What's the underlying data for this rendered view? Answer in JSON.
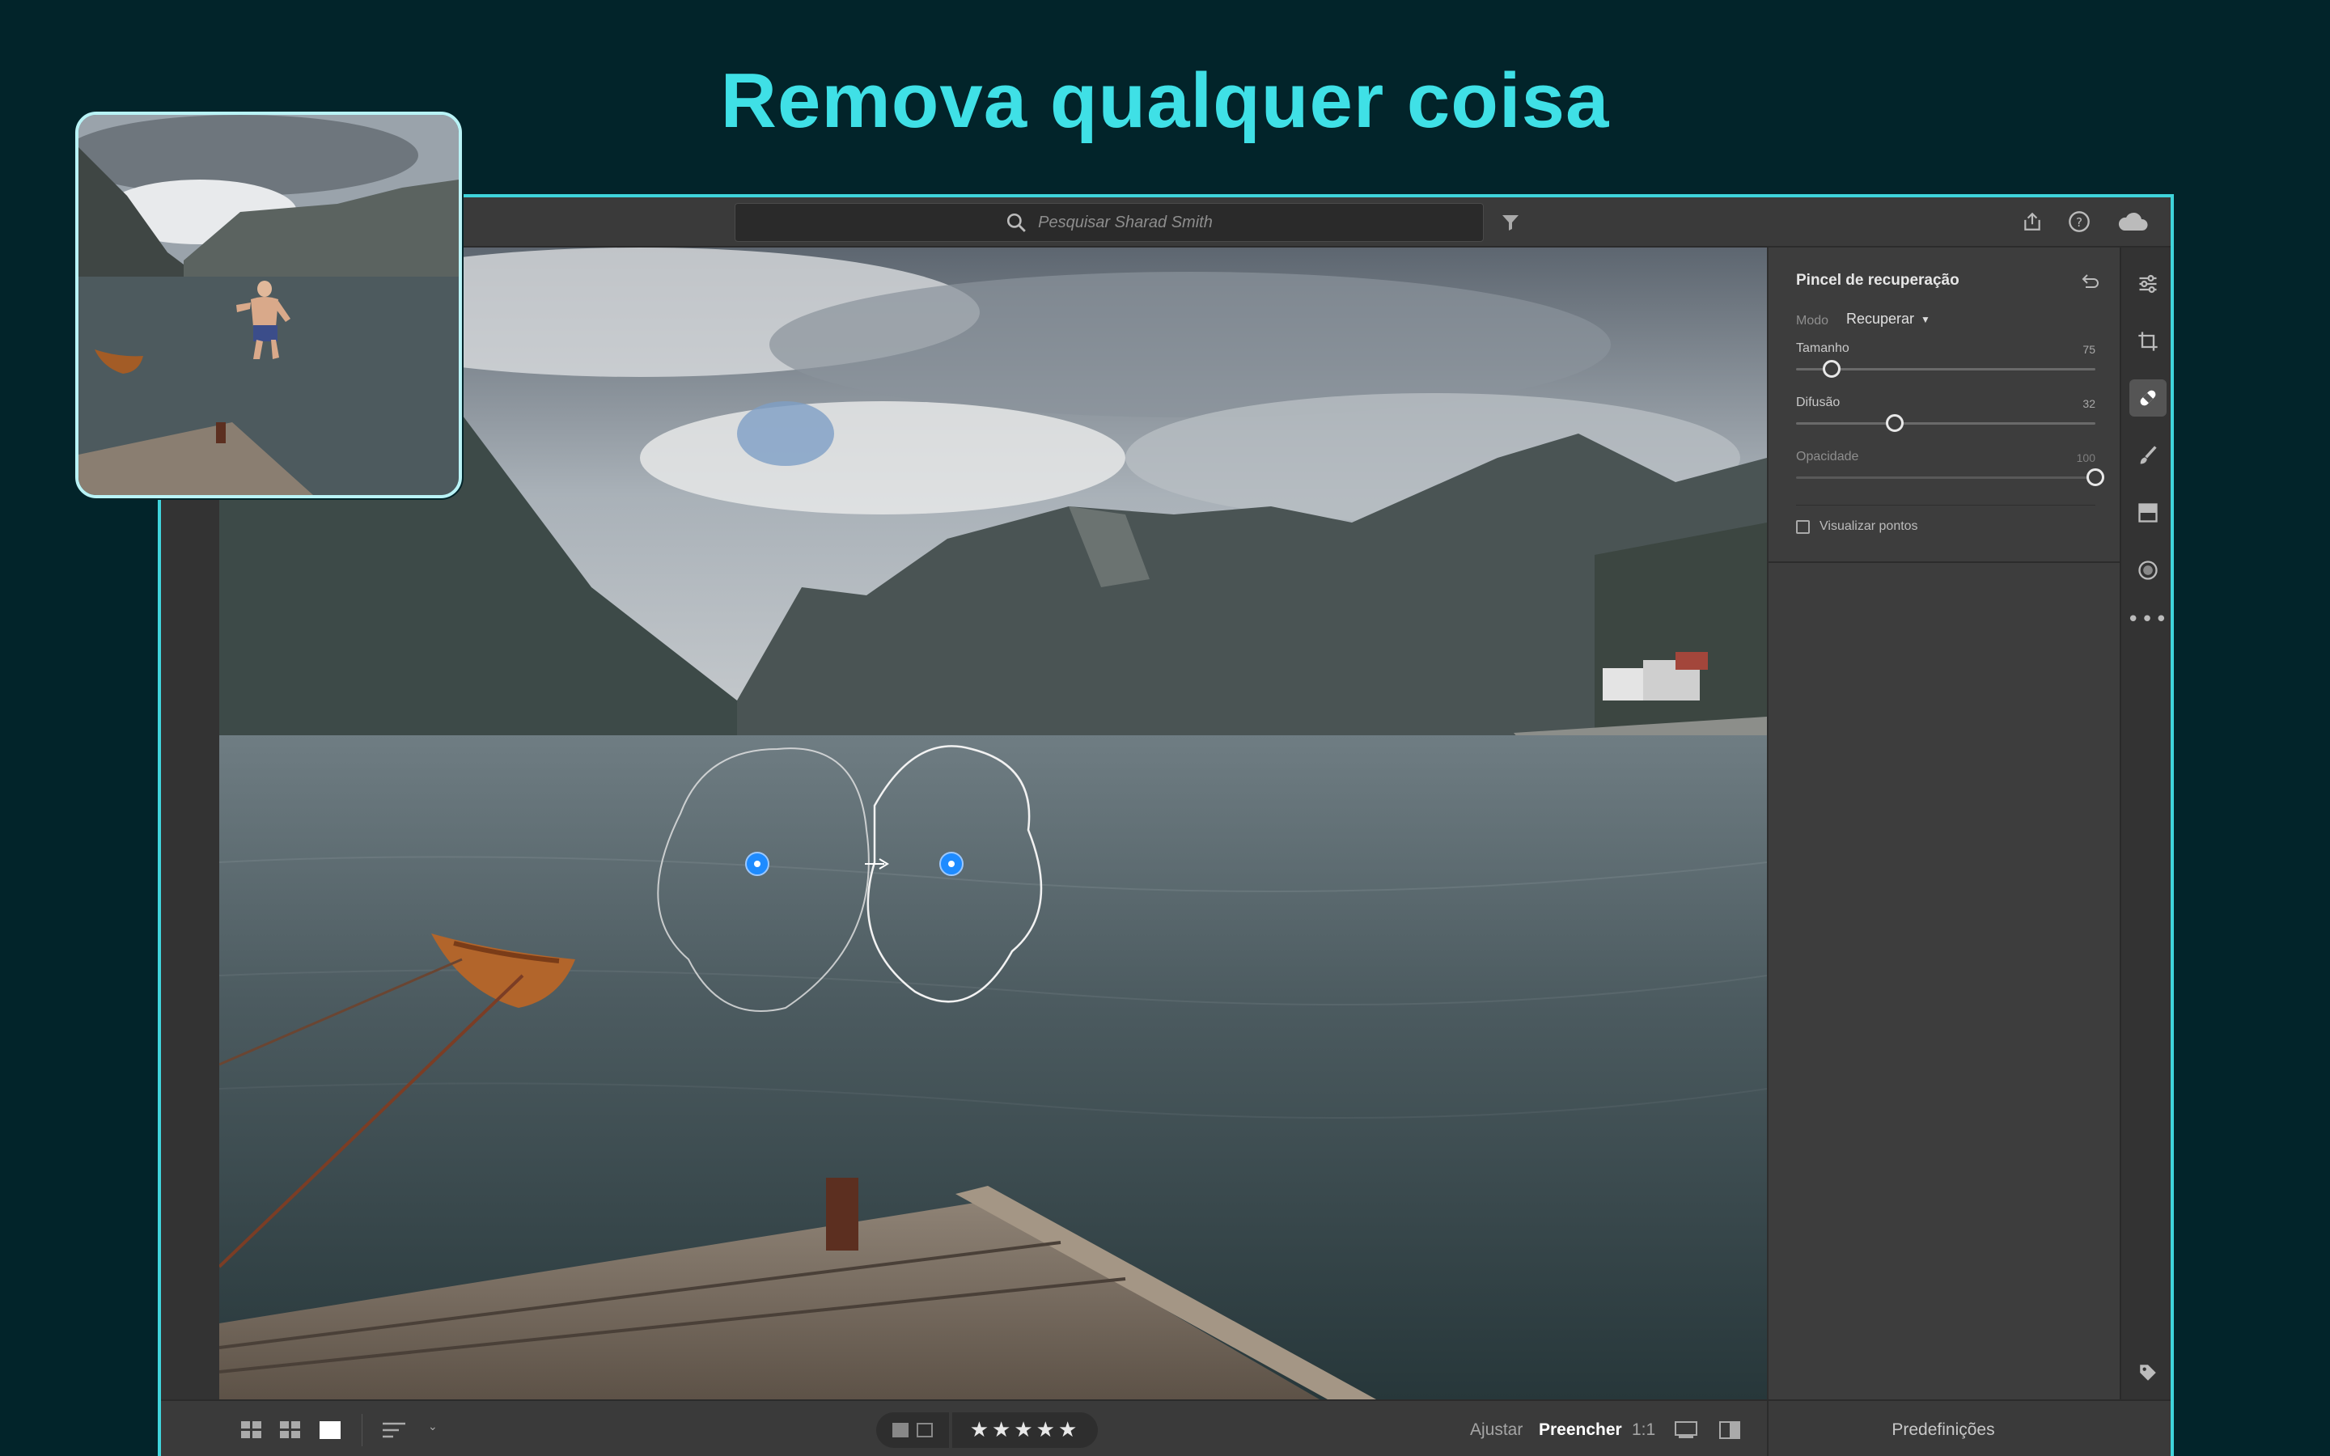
{
  "headline": "Remova qualquer coisa",
  "topbar": {
    "search_placeholder": "Pesquisar Sharad Smith",
    "filter_icon": "filter-icon",
    "share_icon": "share-icon",
    "help_icon": "help-icon",
    "cloud_icon": "cloud-icon"
  },
  "panel": {
    "title": "Pincel de recuperação",
    "mode_label": "Modo",
    "mode_value": "Recuperar",
    "sliders": [
      {
        "label": "Tamanho",
        "value": "75",
        "fraction": 0.12
      },
      {
        "label": "Difusão",
        "value": "32",
        "fraction": 0.33
      },
      {
        "label": "Opacidade",
        "value": "100",
        "fraction": 1.0
      }
    ],
    "checkbox_label": "Visualizar pontos",
    "checkbox_checked": false
  },
  "bottom": {
    "presets_label": "Predefinições",
    "adjust_label": "Ajustar",
    "fill_label": "Preencher",
    "zoom_label": "1:1",
    "stars": "★★★★★"
  },
  "colors": {
    "accent_cyan": "#3fe0e6",
    "background": "#02242a",
    "heal_pin": "#1e8bff"
  }
}
